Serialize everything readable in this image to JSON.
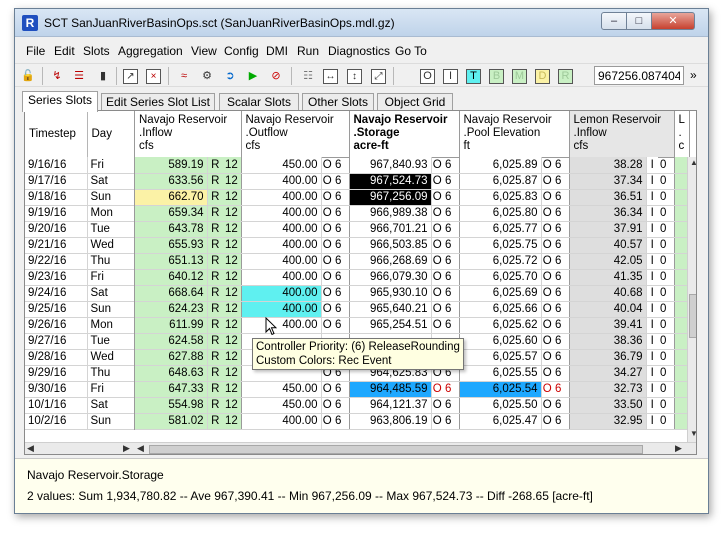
{
  "window": {
    "title": "SCT SanJuanRiverBasinOps.sct (SanJuanRiverBasinOps.mdl.gz)",
    "app_icon_glyph": "R",
    "min_glyph": "–",
    "max_glyph": "□",
    "close_glyph": "✕"
  },
  "menu": [
    "File",
    "Edit",
    "Slots",
    "Aggregation",
    "View",
    "Config",
    "DMI",
    "Run",
    "Diagnostics",
    "Go To"
  ],
  "toolbar": {
    "icons": [
      "lock-icon",
      "link-icon",
      "column-format-icon",
      "row-format-icon",
      "open-dialog-icon",
      "close-dialog-icon",
      "plot-icon",
      "config-icon",
      "run-icon",
      "play-icon",
      "stop-icon",
      "column-select-icon",
      "fit-width-icon",
      "fit-height-icon",
      "fit-all-icon"
    ],
    "flag_buttons": [
      {
        "label": "O",
        "color": "#ffffff"
      },
      {
        "label": "I",
        "color": "#ffffff"
      },
      {
        "label": "T",
        "color": "#5ff0f0"
      },
      {
        "label": "B",
        "color": "#c9f0c4"
      },
      {
        "label": "M",
        "color": "#c9f0c4"
      },
      {
        "label": "D",
        "color": "#fbf2a6"
      },
      {
        "label": "R",
        "color": "#c9f0c4"
      }
    ],
    "value_field": "967256.087404",
    "more_glyph": "»"
  },
  "tabs": [
    {
      "label": "Series Slots",
      "active": true
    },
    {
      "label": "Edit Series Slot List",
      "active": false
    },
    {
      "label": "Scalar Slots",
      "active": false
    },
    {
      "label": "Other Slots",
      "active": false
    },
    {
      "label": "Object Grid",
      "active": false
    }
  ],
  "grid": {
    "fixed_headers": [
      "Timestep",
      "Day"
    ],
    "columns": [
      {
        "line1": "Navajo Reservoir",
        "line2": ".Inflow",
        "line3": "cfs",
        "bold": false
      },
      {
        "line1": "Navajo Reservoir",
        "line2": ".Outflow",
        "line3": "cfs",
        "bold": false
      },
      {
        "line1": "Navajo Reservoir",
        "line2": ".Storage",
        "line3": "acre-ft",
        "bold": true
      },
      {
        "line1": "Navajo Reservoir",
        "line2": ".Pool Elevation",
        "line3": "ft",
        "bold": false
      },
      {
        "line1": "Lemon Reservoir",
        "line2": ".Inflow",
        "line3": "cfs",
        "bold": false
      },
      {
        "line1": "L",
        "line2": ".",
        "line3": "c",
        "bold": false
      }
    ],
    "rows": [
      {
        "date": "9/16/16",
        "day": "Fri",
        "cells": [
          [
            "589.19",
            "R",
            "12",
            "green"
          ],
          [
            "450.00",
            "O",
            "6",
            "white"
          ],
          [
            "967,840.93",
            "O",
            "6",
            "white"
          ],
          [
            "6,025.89",
            "O",
            "6",
            "white"
          ],
          [
            "38.28",
            "I",
            "0",
            "grey"
          ]
        ]
      },
      {
        "date": "9/17/16",
        "day": "Sat",
        "cells": [
          [
            "633.56",
            "R",
            "12",
            "green"
          ],
          [
            "400.00",
            "O",
            "6",
            "white"
          ],
          [
            "967,524.73",
            "O",
            "6",
            "black"
          ],
          [
            "6,025.87",
            "O",
            "6",
            "white"
          ],
          [
            "37.34",
            "I",
            "0",
            "grey"
          ]
        ]
      },
      {
        "date": "9/18/16",
        "day": "Sun",
        "cells": [
          [
            "662.70",
            "R",
            "12",
            "yellow"
          ],
          [
            "400.00",
            "O",
            "6",
            "white"
          ],
          [
            "967,256.09",
            "O",
            "6",
            "black"
          ],
          [
            "6,025.83",
            "O",
            "6",
            "white"
          ],
          [
            "36.51",
            "I",
            "0",
            "grey"
          ]
        ]
      },
      {
        "date": "9/19/16",
        "day": "Mon",
        "cells": [
          [
            "659.34",
            "R",
            "12",
            "green"
          ],
          [
            "400.00",
            "O",
            "6",
            "white"
          ],
          [
            "966,989.38",
            "O",
            "6",
            "white"
          ],
          [
            "6,025.80",
            "O",
            "6",
            "white"
          ],
          [
            "36.34",
            "I",
            "0",
            "grey"
          ]
        ]
      },
      {
        "date": "9/20/16",
        "day": "Tue",
        "cells": [
          [
            "643.78",
            "R",
            "12",
            "green"
          ],
          [
            "400.00",
            "O",
            "6",
            "white"
          ],
          [
            "966,701.21",
            "O",
            "6",
            "white"
          ],
          [
            "6,025.77",
            "O",
            "6",
            "white"
          ],
          [
            "37.91",
            "I",
            "0",
            "grey"
          ]
        ]
      },
      {
        "date": "9/21/16",
        "day": "Wed",
        "cells": [
          [
            "655.93",
            "R",
            "12",
            "green"
          ],
          [
            "400.00",
            "O",
            "6",
            "white"
          ],
          [
            "966,503.85",
            "O",
            "6",
            "white"
          ],
          [
            "6,025.75",
            "O",
            "6",
            "white"
          ],
          [
            "40.57",
            "I",
            "0",
            "grey"
          ]
        ]
      },
      {
        "date": "9/22/16",
        "day": "Thu",
        "cells": [
          [
            "651.13",
            "R",
            "12",
            "green"
          ],
          [
            "400.00",
            "O",
            "6",
            "white"
          ],
          [
            "966,268.69",
            "O",
            "6",
            "white"
          ],
          [
            "6,025.72",
            "O",
            "6",
            "white"
          ],
          [
            "42.05",
            "I",
            "0",
            "grey"
          ]
        ]
      },
      {
        "date": "9/23/16",
        "day": "Fri",
        "cells": [
          [
            "640.12",
            "R",
            "12",
            "green"
          ],
          [
            "400.00",
            "O",
            "6",
            "white"
          ],
          [
            "966,079.30",
            "O",
            "6",
            "white"
          ],
          [
            "6,025.70",
            "O",
            "6",
            "white"
          ],
          [
            "41.35",
            "I",
            "0",
            "grey"
          ]
        ]
      },
      {
        "date": "9/24/16",
        "day": "Sat",
        "cells": [
          [
            "668.64",
            "R",
            "12",
            "green"
          ],
          [
            "400.00",
            "O",
            "6",
            "cyan"
          ],
          [
            "965,930.10",
            "O",
            "6",
            "white"
          ],
          [
            "6,025.69",
            "O",
            "6",
            "white"
          ],
          [
            "40.68",
            "I",
            "0",
            "grey"
          ]
        ]
      },
      {
        "date": "9/25/16",
        "day": "Sun",
        "cells": [
          [
            "624.23",
            "R",
            "12",
            "green"
          ],
          [
            "400.00",
            "O",
            "6",
            "cyan"
          ],
          [
            "965,640.21",
            "O",
            "6",
            "white"
          ],
          [
            "6,025.66",
            "O",
            "6",
            "white"
          ],
          [
            "40.04",
            "I",
            "0",
            "grey"
          ]
        ]
      },
      {
        "date": "9/26/16",
        "day": "Mon",
        "cells": [
          [
            "611.99",
            "R",
            "12",
            "green"
          ],
          [
            "400.00",
            "O",
            "6",
            "white"
          ],
          [
            "965,254.51",
            "O",
            "6",
            "white"
          ],
          [
            "6,025.62",
            "O",
            "6",
            "white"
          ],
          [
            "39.41",
            "I",
            "0",
            "grey"
          ]
        ]
      },
      {
        "date": "9/27/16",
        "day": "Tue",
        "cells": [
          [
            "624.58",
            "R",
            "12",
            "green"
          ],
          [
            "",
            "",
            "",
            "white"
          ],
          [
            "",
            "",
            "",
            "white"
          ],
          [
            "6,025.60",
            "O",
            "6",
            "white"
          ],
          [
            "38.36",
            "I",
            "0",
            "grey"
          ]
        ]
      },
      {
        "date": "9/28/16",
        "day": "Wed",
        "cells": [
          [
            "627.88",
            "R",
            "12",
            "green"
          ],
          [
            "",
            "",
            "",
            "white"
          ],
          [
            "",
            "",
            "",
            "white"
          ],
          [
            "6,025.57",
            "O",
            "6",
            "white"
          ],
          [
            "36.79",
            "I",
            "0",
            "grey"
          ]
        ]
      },
      {
        "date": "9/29/16",
        "day": "Thu",
        "cells": [
          [
            "648.63",
            "R",
            "12",
            "green"
          ],
          [
            "",
            "O",
            "6",
            "white"
          ],
          [
            "964,625.83",
            "O",
            "6",
            "white"
          ],
          [
            "6,025.55",
            "O",
            "6",
            "white"
          ],
          [
            "34.27",
            "I",
            "0",
            "grey"
          ]
        ]
      },
      {
        "date": "9/30/16",
        "day": "Fri",
        "cells": [
          [
            "647.33",
            "R",
            "12",
            "green"
          ],
          [
            "450.00",
            "O",
            "6",
            "white"
          ],
          [
            "964,485.59",
            "O",
            "6",
            "blue"
          ],
          [
            "6,025.54",
            "O",
            "6",
            "blue"
          ],
          [
            "32.73",
            "I",
            "0",
            "grey"
          ]
        ]
      },
      {
        "date": "10/1/16",
        "day": "Sat",
        "cells": [
          [
            "554.98",
            "R",
            "12",
            "green"
          ],
          [
            "450.00",
            "O",
            "6",
            "white"
          ],
          [
            "964,121.37",
            "O",
            "6",
            "white"
          ],
          [
            "6,025.50",
            "O",
            "6",
            "white"
          ],
          [
            "33.50",
            "I",
            "0",
            "grey"
          ]
        ]
      },
      {
        "date": "10/2/16",
        "day": "Sun",
        "cells": [
          [
            "581.02",
            "R",
            "12",
            "green"
          ],
          [
            "400.00",
            "O",
            "6",
            "white"
          ],
          [
            "963,806.19",
            "O",
            "6",
            "white"
          ],
          [
            "6,025.47",
            "O",
            "6",
            "white"
          ],
          [
            "32.95",
            "I",
            "0",
            "grey"
          ]
        ]
      }
    ],
    "red_flags": [
      [
        14,
        2
      ],
      [
        14,
        3
      ]
    ]
  },
  "tooltip": {
    "line1": "Controller Priority: (6) ReleaseRounding",
    "line2": "Custom Colors: Rec Event"
  },
  "status": {
    "slot_name": "Navajo Reservoir.Storage",
    "stats": "2 values:  Sum 1,934,780.82 -- Ave 967,390.41 -- Min 967,256.09 -- Max 967,524.73 -- Diff -268.65 [acre-ft]"
  }
}
